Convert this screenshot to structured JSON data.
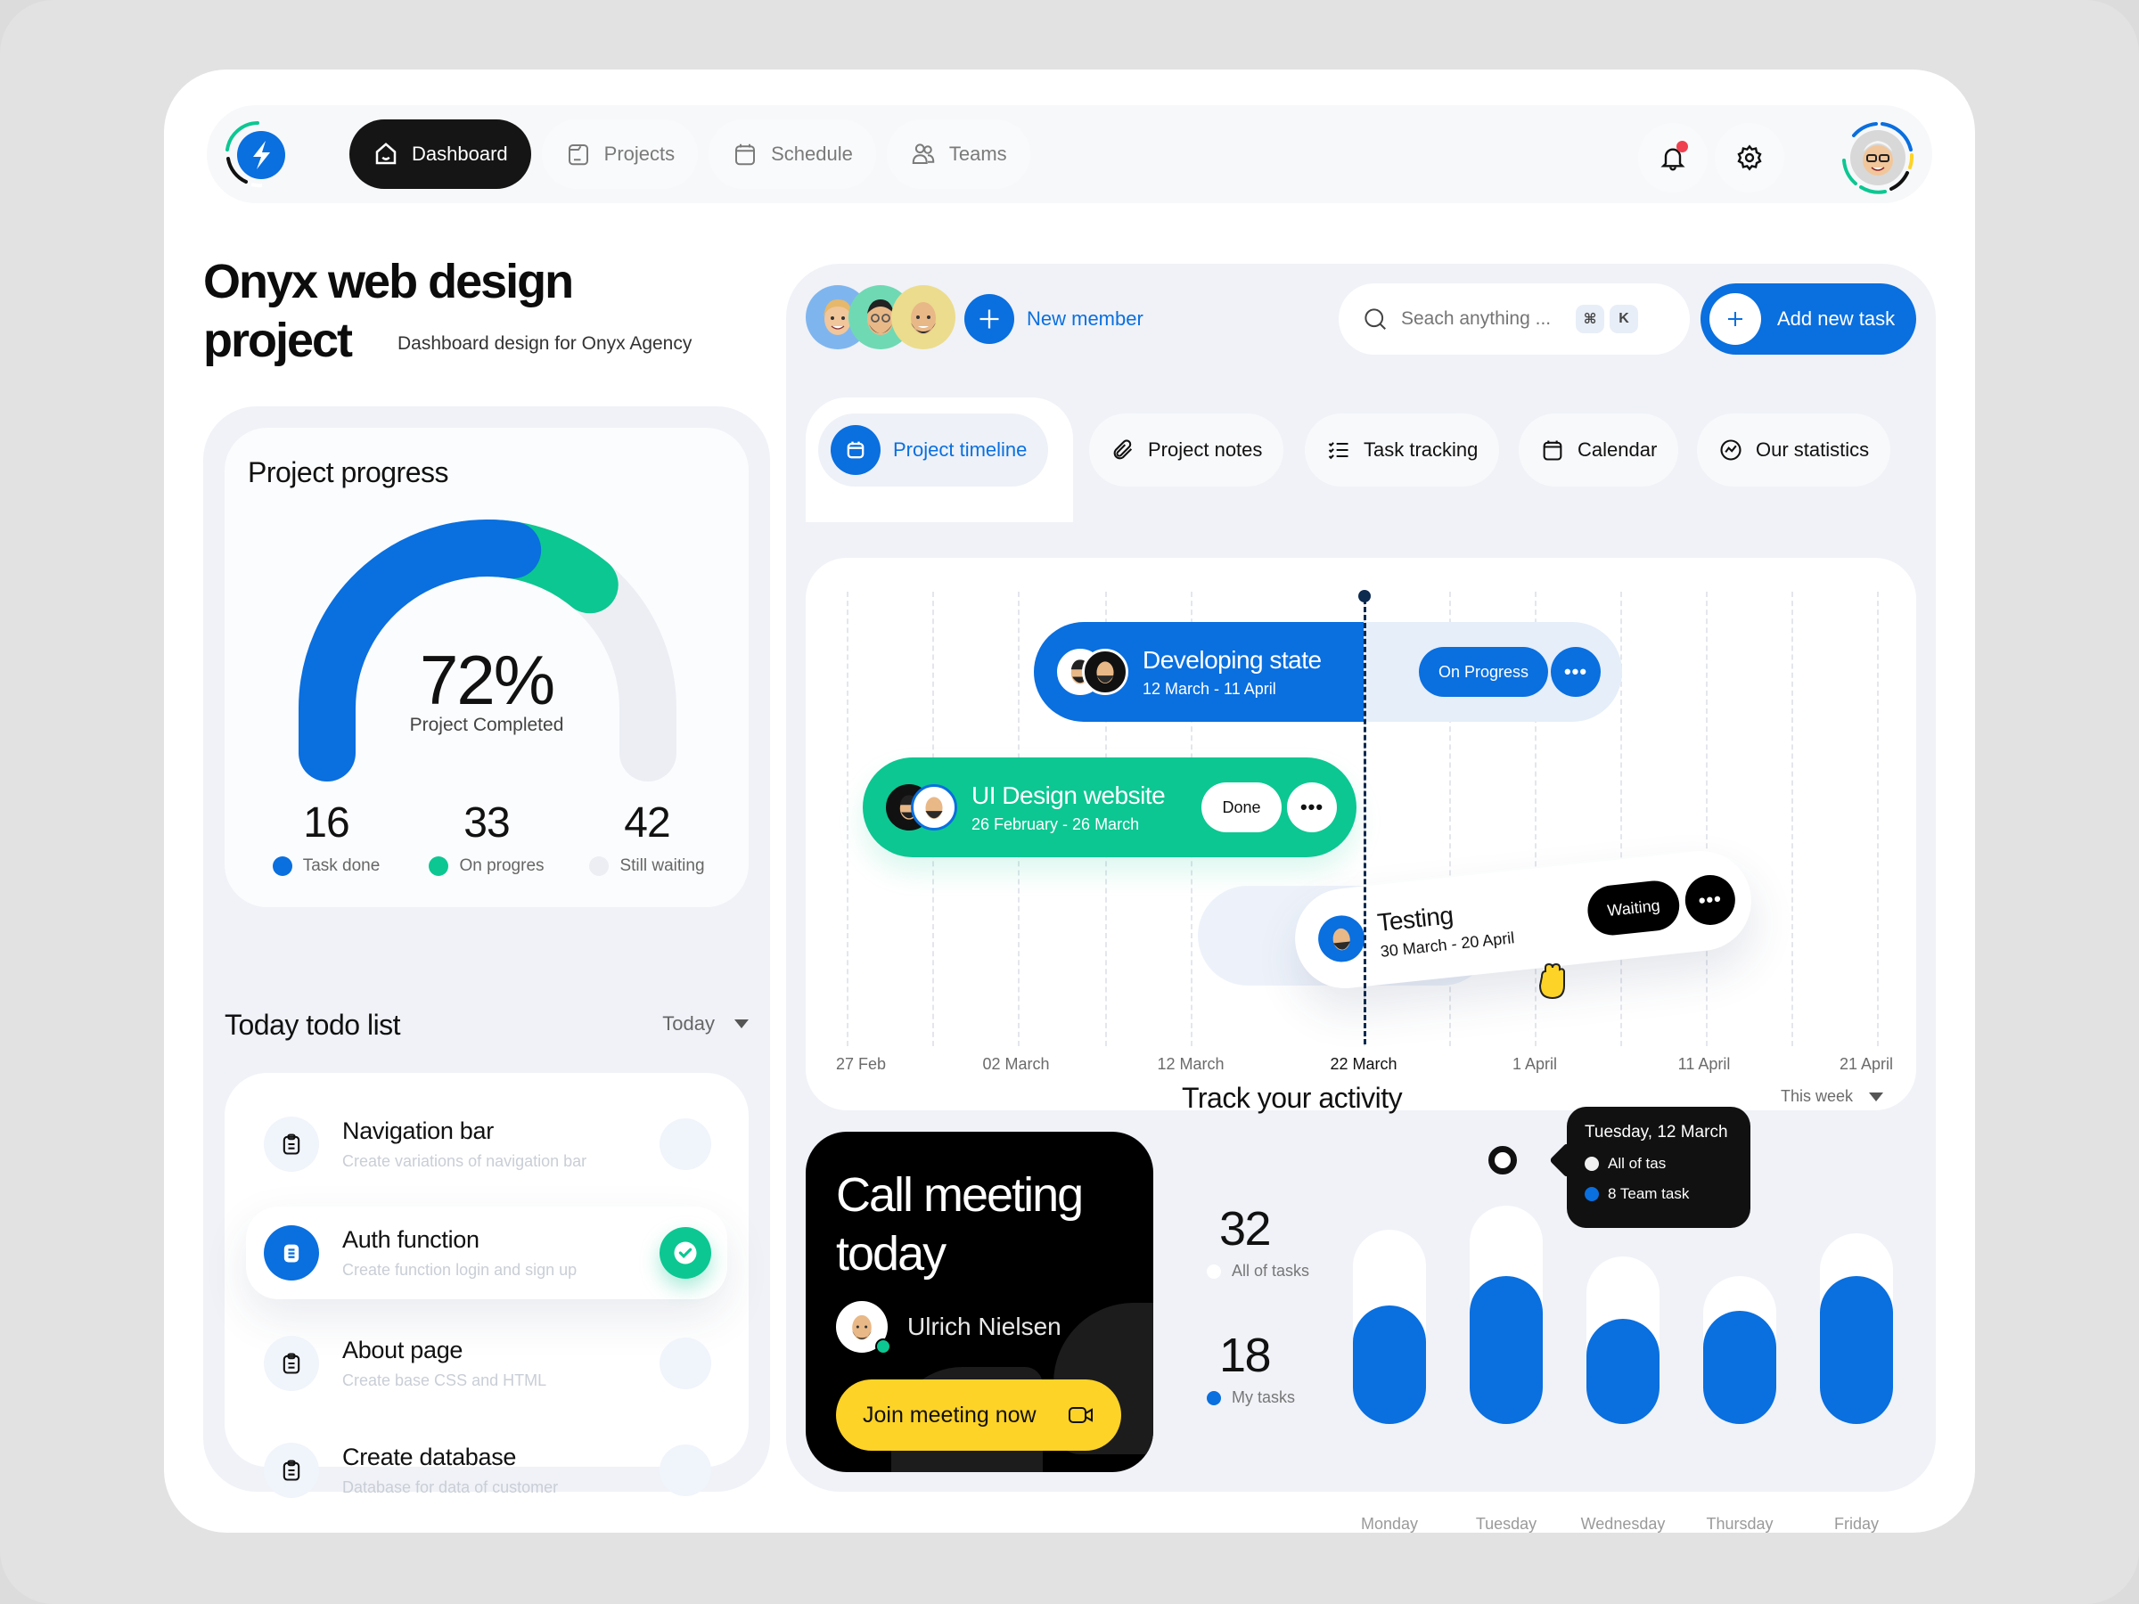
{
  "nav": {
    "tabs": [
      {
        "label": "Dashboard",
        "icon": "home-icon",
        "active": true
      },
      {
        "label": "Projects",
        "icon": "folder-icon",
        "active": false
      },
      {
        "label": "Schedule",
        "icon": "calendar-icon",
        "active": false
      },
      {
        "label": "Teams",
        "icon": "users-icon",
        "active": false
      }
    ],
    "notifications_unread": true
  },
  "header": {
    "title": "Onyx web design project",
    "subtitle": "Dashboard design for Onyx Agency"
  },
  "progress": {
    "title": "Project progress",
    "percent_label": "72%",
    "percent": 72,
    "caption": "Project Completed",
    "segments": {
      "done_fraction": 0.55,
      "progress_fraction": 0.17,
      "waiting_fraction": 0.28
    },
    "stats": [
      {
        "value": "16",
        "label": "Task done",
        "color": "#0a6fdf"
      },
      {
        "value": "33",
        "label": "On progres",
        "color": "#0cc792"
      },
      {
        "value": "42",
        "label": "Still waiting",
        "color": "#eceef4"
      }
    ]
  },
  "todo": {
    "title": "Today todo list",
    "filter": "Today",
    "items": [
      {
        "name": "Navigation bar",
        "desc": "Create variations of navigation bar",
        "done": false
      },
      {
        "name": "Auth function",
        "desc": "Create function login and sign up",
        "done": true
      },
      {
        "name": "About page",
        "desc": "Create base CSS and HTML",
        "done": false
      },
      {
        "name": "Create database",
        "desc": "Database for data of customer",
        "done": false
      }
    ]
  },
  "toolbar": {
    "new_member_label": "New member",
    "search_placeholder": "Seach anything ...",
    "shortcut_keys": [
      "⌘",
      "K"
    ],
    "add_task_label": "Add new task"
  },
  "tabs": [
    {
      "label": "Project timeline",
      "icon": "calendar-icon",
      "active": true
    },
    {
      "label": "Project notes",
      "icon": "paperclip-icon",
      "active": false
    },
    {
      "label": "Task tracking",
      "icon": "checklist-icon",
      "active": false
    },
    {
      "label": "Calendar",
      "icon": "calendar-icon",
      "active": false
    },
    {
      "label": "Our statistics",
      "icon": "chart-icon",
      "active": false
    }
  ],
  "timeline": {
    "axis": [
      "27 Feb",
      "02 March",
      "12 March",
      "22 March",
      "1 April",
      "11 April",
      "21 April"
    ],
    "today": "22 March",
    "tasks": [
      {
        "name": "Developing state",
        "dates": "12 March - 11 April",
        "status": "On Progress",
        "color": "#0a6fdf"
      },
      {
        "name": "UI Design website",
        "dates": "26 February - 26 March",
        "status": "Done",
        "color": "#0cc792"
      },
      {
        "name": "Testing",
        "dates": "30 March - 20 April",
        "status": "Waiting",
        "color": "#ffffff"
      }
    ]
  },
  "meeting": {
    "title": "Call meeting today",
    "host": "Ulrich Nielsen",
    "join_label": "Join meeting now"
  },
  "activity": {
    "title": "Track your activity",
    "filter": "This week",
    "all_tasks_value": "32",
    "all_tasks_label": "All of tasks",
    "my_tasks_value": "18",
    "my_tasks_label": "My tasks",
    "tooltip": {
      "title": "Tuesday, 12 March",
      "row1": "All of tas",
      "row2": "8 Team task"
    }
  },
  "chart_data": {
    "type": "bar",
    "title": "Track your activity",
    "categories": [
      "Monday",
      "Tuesday",
      "Wednesday",
      "Thursday",
      "Friday"
    ],
    "series": [
      {
        "name": "All of tasks",
        "color": "#ffffff",
        "values": [
          10,
          11.2,
          8.6,
          7.6,
          9.8
        ]
      },
      {
        "name": "My tasks",
        "color": "#0a6fdf",
        "values": [
          6.1,
          7.6,
          5.4,
          5.8,
          7.6
        ]
      }
    ],
    "ylim": [
      0,
      12
    ],
    "legend": "left"
  }
}
